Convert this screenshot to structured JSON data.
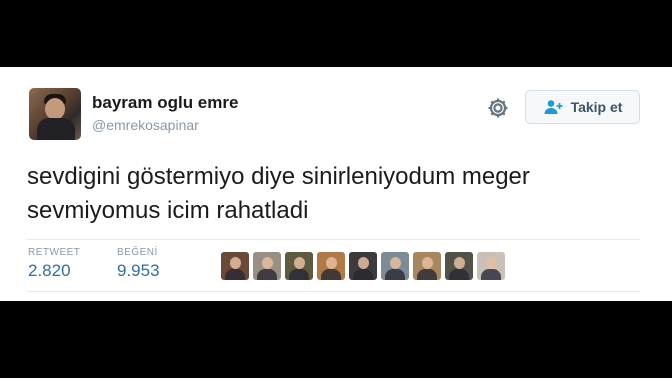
{
  "tweet": {
    "author_name": "bayram oglu emre",
    "author_handle": "@emrekosapinar",
    "follow_label": "Takip et",
    "text": "sevdigini göstermiyo diye sinirleniyodum meger sevmiyomus icim rahatladi"
  },
  "stats": {
    "retweet_label": "RETWEET",
    "retweet_count": "2.820",
    "like_label": "BEĞENİ",
    "like_count": "9.953"
  },
  "likers": [
    {
      "color": "#6b4a3a"
    },
    {
      "color": "#9a8f84"
    },
    {
      "color": "#5d5a3f"
    },
    {
      "color": "#b07a48"
    },
    {
      "color": "#3c3a3c"
    },
    {
      "color": "#7c8c96"
    },
    {
      "color": "#a88760"
    },
    {
      "color": "#51524a"
    },
    {
      "color": "#c9c0b8"
    }
  ],
  "colors": {
    "link_blue": "#2f6fa5",
    "muted_text": "#8899a6",
    "icon_gray": "#66757f"
  }
}
